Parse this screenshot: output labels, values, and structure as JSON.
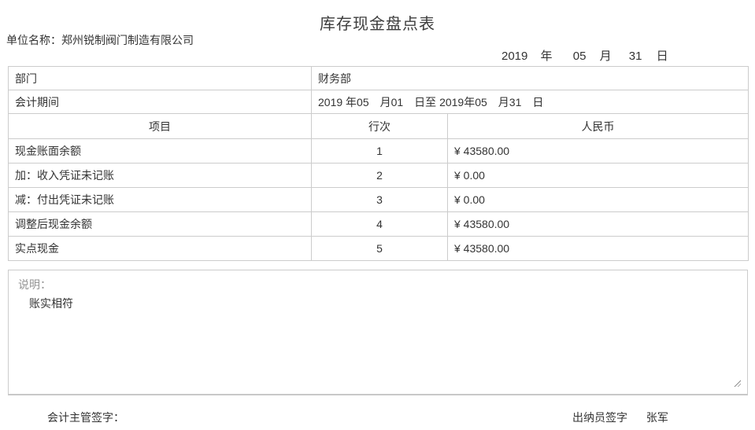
{
  "page": {
    "title": "库存现金盘点表",
    "unit_label": "单位名称：郑州锐制阀门制造有限公司"
  },
  "header_date": {
    "year": "2019",
    "year_label": "年",
    "month": "05",
    "month_label": "月",
    "day": "31",
    "day_label": "日"
  },
  "info_rows": {
    "department_label": "部门",
    "department_value": "财务部",
    "period_label": "会计期间",
    "period_value": "2019 年05　月01　日至 2019年05　月31　日"
  },
  "columns": {
    "item": "项目",
    "line": "行次",
    "currency": "人民币"
  },
  "rows": [
    {
      "item": "现金账面余额",
      "line": "1",
      "amount": "¥ 43580.00"
    },
    {
      "item": "加：收入凭证未记账",
      "line": "2",
      "amount": "¥ 0.00"
    },
    {
      "item": "减：付出凭证未记账",
      "line": "3",
      "amount": "¥ 0.00"
    },
    {
      "item": "调整后现金余额",
      "line": "4",
      "amount": "¥ 43580.00"
    },
    {
      "item": "实点现金",
      "line": "5",
      "amount": "¥ 43580.00"
    }
  ],
  "note": {
    "label": "说明：",
    "content": "账实相符"
  },
  "signatures": {
    "accounting_label": "会计主管签字：",
    "cashier_label": "出纳员签字",
    "cashier_name": "张军"
  },
  "colors": {
    "border": "#cccccc",
    "text": "#333333",
    "muted_label": "#949494",
    "background": "#ffffff"
  }
}
